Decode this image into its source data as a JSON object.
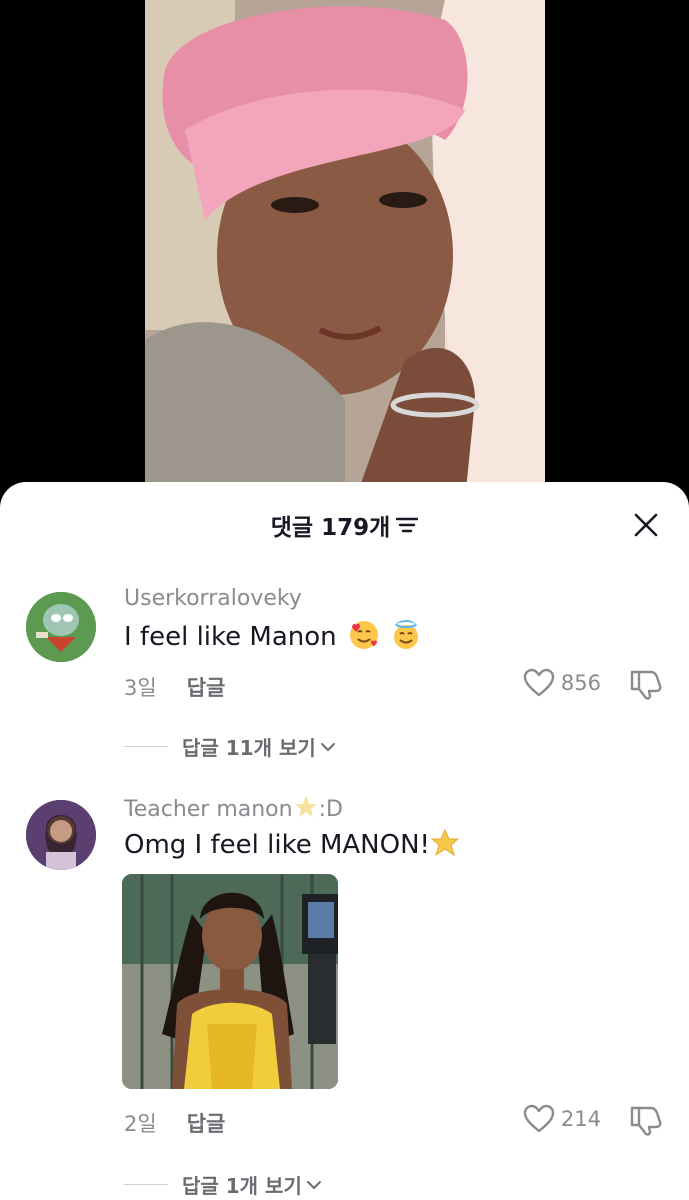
{
  "header": {
    "title": "댓글 179개"
  },
  "comments": [
    {
      "username": "Userkorraloveky",
      "text": "I feel like Manon",
      "emojis": [
        "smiling-face-with-hearts",
        "smiling-face-with-halo"
      ],
      "age": "3일",
      "reply_label": "답글",
      "likes": "856",
      "view_replies": "답글 11개 보기"
    },
    {
      "username": "Teacher manon",
      "username_emoji": "star",
      "username_suffix": ":D",
      "text": "Omg I feel like MANON!",
      "emojis": [
        "star"
      ],
      "age": "2일",
      "reply_label": "답글",
      "likes": "214",
      "view_replies": "답글 1개 보기"
    }
  ],
  "colors": {
    "sheet_bg": "#ffffff",
    "text_primary": "#161823",
    "text_secondary": "#8a8b91",
    "star": "#f7c948"
  }
}
